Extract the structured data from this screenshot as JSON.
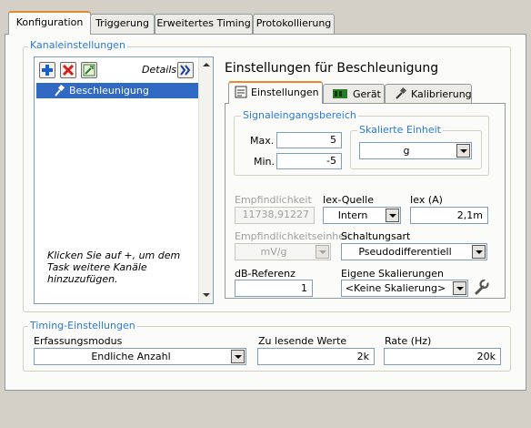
{
  "tabs": [
    "Konfiguration",
    "Triggerung",
    "Erweitertes Timing",
    "Protokollierung"
  ],
  "channel_settings": {
    "legend": "Kanaleinstellungen",
    "details_label": "Details",
    "channel_item": "Beschleunigung",
    "hint": "Klicken Sie auf +, um dem Task weitere Kanäle hinzuzufügen."
  },
  "settings": {
    "title": "Einstellungen für Beschleunigung",
    "subtabs": [
      "Einstellungen",
      "Gerät",
      "Kalibrierung"
    ],
    "signal_range": {
      "legend": "Signaleingangsbereich",
      "max_label": "Max.",
      "max_value": "5",
      "min_label": "Min.",
      "min_value": "-5"
    },
    "scaled_unit": {
      "legend": "Skalierte Einheit",
      "value": "g"
    },
    "sensitivity": {
      "label": "Empfindlichkeit",
      "value": "11738,91227"
    },
    "iex_source": {
      "label": "Iex-Quelle",
      "value": "Intern"
    },
    "iex": {
      "label": "Iex (A)",
      "value": "2,1m"
    },
    "sensitivity_unit": {
      "label": "Empfindlichkeitseinheit",
      "value": "mV/g"
    },
    "circuit": {
      "label": "Schaltungsart",
      "value": "Pseudodifferentiell"
    },
    "db_ref": {
      "label": "dB-Referenz",
      "value": "1"
    },
    "custom_scaling": {
      "label": "Eigene Skalierungen",
      "value": "<Keine Skalierung>"
    }
  },
  "timing": {
    "legend": "Timing-Einstellungen",
    "mode_label": "Erfassungsmodus",
    "mode_value": "Endliche Anzahl",
    "samples_label": "Zu lesende Werte",
    "samples_value": "2k",
    "rate_label": "Rate (Hz)",
    "rate_value": "20k"
  },
  "colors": {
    "accent": "#2a7ad8",
    "selection": "#316ac5",
    "tab_highlight": "#e68b2c"
  }
}
